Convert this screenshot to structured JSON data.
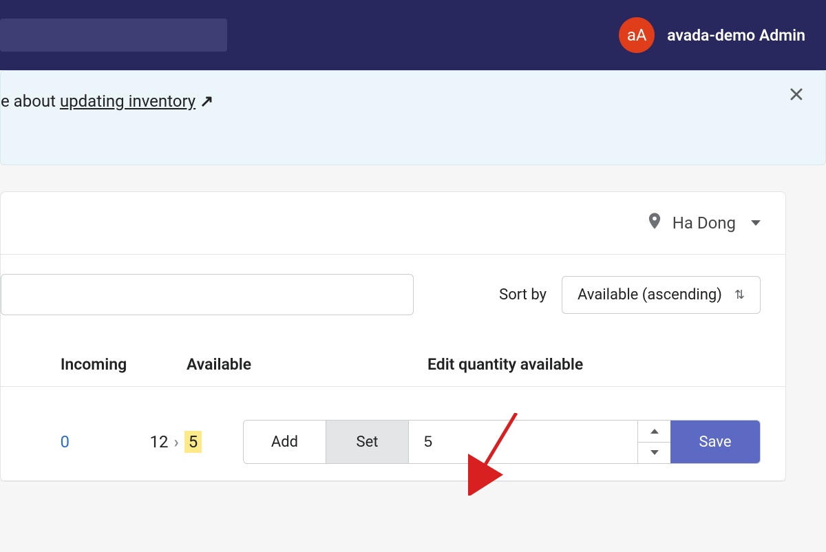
{
  "header": {
    "avatar_initials": "aA",
    "admin_name": "avada-demo Admin"
  },
  "notice": {
    "text_fragment": "e about ",
    "link_label": "updating inventory"
  },
  "location": {
    "name": "Ha Dong"
  },
  "sort": {
    "label": "Sort by",
    "selected": "Available (ascending)"
  },
  "columns": {
    "incoming": "Incoming",
    "available": "Available",
    "edit": "Edit quantity available"
  },
  "row": {
    "incoming": "0",
    "available_old": "12",
    "available_new": "5",
    "add_label": "Add",
    "set_label": "Set",
    "quantity_value": "5",
    "save_label": "Save"
  }
}
